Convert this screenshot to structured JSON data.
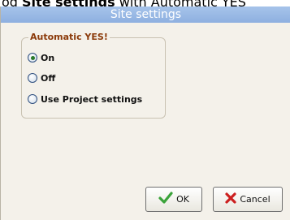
{
  "caption": {
    "prefix": "og ",
    "bold": "Site settings",
    "suffix": " with Automatic YES"
  },
  "dialog": {
    "title": "Site settings",
    "group": {
      "title": "Automatic YES!",
      "options": [
        {
          "label": "On",
          "selected": true
        },
        {
          "label": "Off",
          "selected": false
        },
        {
          "label": "Use Project settings",
          "selected": false
        }
      ]
    },
    "buttons": {
      "ok": "OK",
      "cancel": "Cancel"
    },
    "colors": {
      "titlebar": "#9bbbe6",
      "background": "#f4f1ea",
      "group_title": "#8b3a0a",
      "ok_icon": "#3aa33a",
      "cancel_icon": "#cc1f1f"
    }
  }
}
